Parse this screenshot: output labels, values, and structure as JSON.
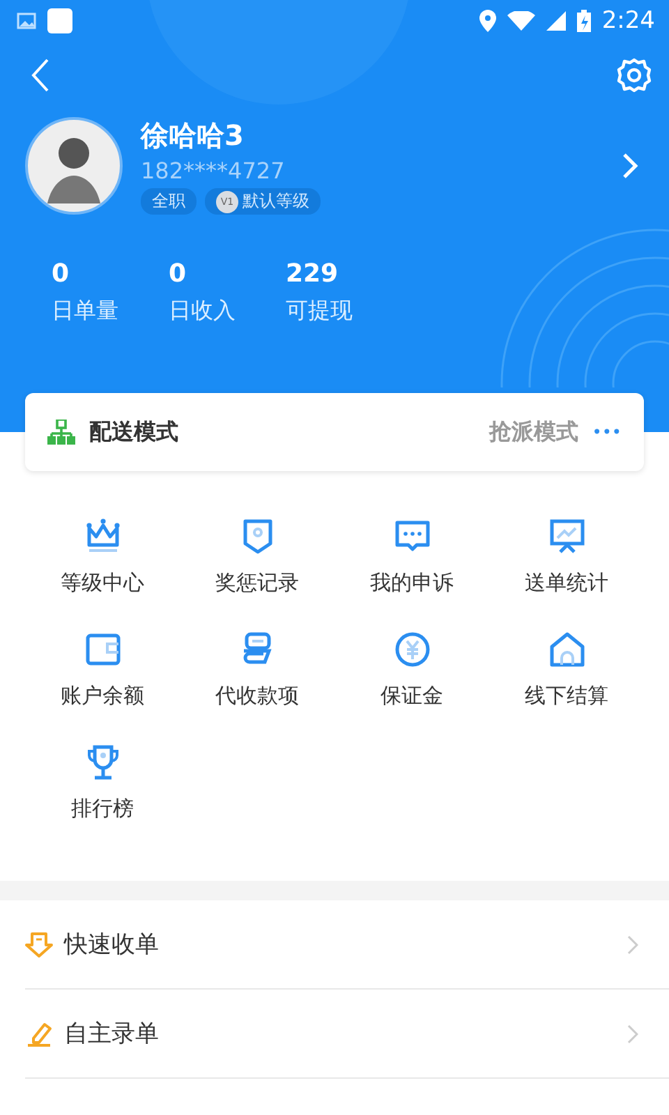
{
  "status_bar": {
    "time": "2:24"
  },
  "profile": {
    "name": "徐哈哈3",
    "phone": "182****4727",
    "tags": [
      {
        "kind": "plain",
        "label": "全职"
      },
      {
        "kind": "level",
        "badge": "V1",
        "label": "默认等级"
      }
    ]
  },
  "stats": [
    {
      "value": "0",
      "label": "日单量"
    },
    {
      "value": "0",
      "label": "日收入"
    },
    {
      "value": "229",
      "label": "可提现"
    }
  ],
  "delivery_mode": {
    "title": "配送模式",
    "value": "抢派模式",
    "more": "•••"
  },
  "grid": [
    {
      "label": "等级中心"
    },
    {
      "label": "奖惩记录"
    },
    {
      "label": "我的申诉"
    },
    {
      "label": "送单统计"
    },
    {
      "label": "账户余额"
    },
    {
      "label": "代收款项"
    },
    {
      "label": "保证金"
    },
    {
      "label": "线下结算"
    },
    {
      "label": "排行榜"
    }
  ],
  "list": [
    {
      "label": "快速收单"
    },
    {
      "label": "自主录单"
    }
  ]
}
